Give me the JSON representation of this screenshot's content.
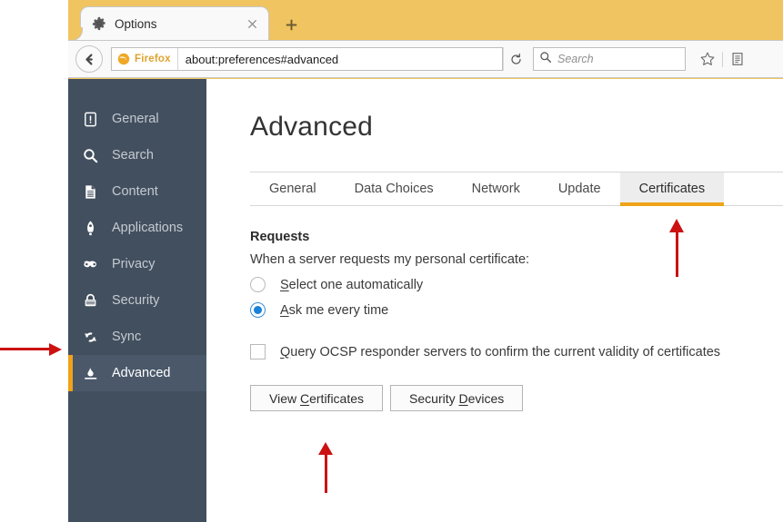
{
  "browser": {
    "tab": {
      "title": "Options",
      "gear_icon": "gear-icon",
      "close_icon": "close-icon"
    },
    "new_tab_label": "+",
    "back_icon": "back-arrow-icon",
    "identity_label": "Firefox",
    "identity_icon": "firefox-globe-icon",
    "url": "about:preferences#advanced",
    "reload_icon": "reload-icon",
    "search": {
      "placeholder": "Search",
      "icon": "search-icon"
    },
    "toolbar_icons": [
      {
        "name": "bookmark-star-icon"
      },
      {
        "name": "library-icon"
      }
    ],
    "colors": {
      "titlebar": "#f0c460",
      "accent_orange": "#f0a318",
      "sidebar": "#424f5e",
      "sidebar_selected": "#4a586a",
      "radio_blue": "#1a82d8",
      "arrow_red": "#cc1111"
    }
  },
  "sidebar": {
    "items": [
      {
        "label": "General",
        "icon": "general-icon",
        "selected": false
      },
      {
        "label": "Search",
        "icon": "search-icon",
        "selected": false
      },
      {
        "label": "Content",
        "icon": "content-page-icon",
        "selected": false
      },
      {
        "label": "Applications",
        "icon": "applications-icon",
        "selected": false
      },
      {
        "label": "Privacy",
        "icon": "privacy-mask-icon",
        "selected": false
      },
      {
        "label": "Security",
        "icon": "security-lock-icon",
        "selected": false
      },
      {
        "label": "Sync",
        "icon": "sync-icon",
        "selected": false
      },
      {
        "label": "Advanced",
        "icon": "advanced-icon",
        "selected": true
      }
    ]
  },
  "main": {
    "title": "Advanced",
    "tabs": [
      {
        "label": "General",
        "active": false
      },
      {
        "label": "Data Choices",
        "active": false
      },
      {
        "label": "Network",
        "active": false
      },
      {
        "label": "Update",
        "active": false
      },
      {
        "label": "Certificates",
        "active": true
      }
    ],
    "requests": {
      "heading": "Requests",
      "description": "When a server requests my personal certificate:",
      "options": [
        {
          "label_pre": "",
          "accesskey": "S",
          "label_post": "elect one automatically",
          "selected": false
        },
        {
          "label_pre": "",
          "accesskey": "A",
          "label_post": "sk me every time",
          "selected": true
        }
      ]
    },
    "ocsp": {
      "accesskey": "Q",
      "label_post": "uery OCSP responder servers to confirm the current validity of certificates",
      "checked": false
    },
    "buttons": [
      {
        "pre": "View ",
        "accesskey": "C",
        "post": "ertificates"
      },
      {
        "pre": "Security ",
        "accesskey": "D",
        "post": "evices"
      }
    ]
  },
  "annotations": [
    {
      "name": "arrow-pointing-to-sync",
      "direction": "right"
    },
    {
      "name": "arrow-pointing-to-certificates-tab",
      "direction": "up"
    },
    {
      "name": "arrow-pointing-to-view-certificates",
      "direction": "up"
    }
  ]
}
